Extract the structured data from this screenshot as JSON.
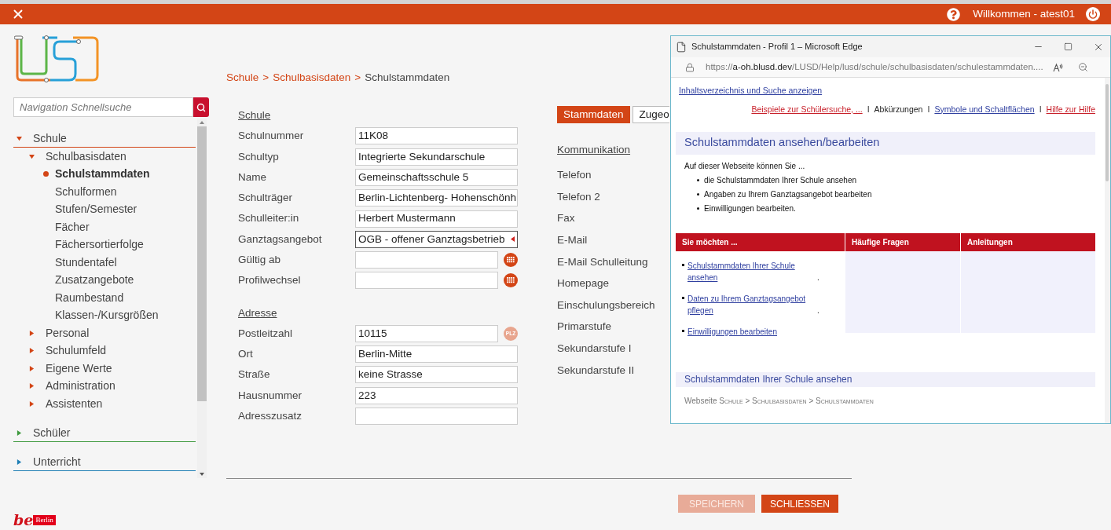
{
  "topbar": {
    "welcome": "Willkommen - atest01"
  },
  "search": {
    "placeholder": "Navigation Schnellsuche"
  },
  "nav": [
    {
      "label": "Schule",
      "color": "#d34516",
      "expanded": true,
      "children": [
        {
          "label": "Schulbasisdaten",
          "expanded": true,
          "children": [
            {
              "label": "Schulstammdaten",
              "selected": true
            },
            {
              "label": "Schulformen",
              "selected": false
            },
            {
              "label": "Stufen/Semester",
              "selected": false
            },
            {
              "label": "Fächer",
              "selected": false
            },
            {
              "label": "Fächersortierfolge",
              "selected": false
            },
            {
              "label": "Stundentafel",
              "selected": false
            },
            {
              "label": "Zusatzangebote",
              "selected": false
            },
            {
              "label": "Raumbestand",
              "selected": false
            },
            {
              "label": "Klassen-/Kursgrößen",
              "selected": false
            }
          ]
        },
        {
          "label": "Personal",
          "expanded": false
        },
        {
          "label": "Schulumfeld",
          "expanded": false
        },
        {
          "label": "Eigene Werte",
          "expanded": false
        },
        {
          "label": "Administration",
          "expanded": false
        },
        {
          "label": "Assistenten",
          "expanded": false
        }
      ]
    },
    {
      "label": "Schüler",
      "color": "#3f9a3f",
      "expanded": false
    },
    {
      "label": "Unterricht",
      "color": "#1f7fb5",
      "expanded": false
    }
  ],
  "footer_logo": {
    "mark": "be",
    "name": "Berlin"
  },
  "breadcrumb": [
    {
      "label": "Schule",
      "link": true
    },
    {
      "label": "Schulbasisdaten",
      "link": true
    },
    {
      "label": "Schulstammdaten",
      "link": false
    }
  ],
  "breadcrumb_separator": ">",
  "school": {
    "heading": "Schule",
    "fields": [
      {
        "label": "Schulnummer",
        "kind": "text",
        "value": "11K08"
      },
      {
        "label": "Schultyp",
        "kind": "text",
        "value": "Integrierte Sekundarschule"
      },
      {
        "label": "Name",
        "kind": "text",
        "value": "Gemeinschaftsschule 5"
      },
      {
        "label": "Schulträger",
        "kind": "text",
        "value": "Berlin-Lichtenberg- Hohenschönh"
      },
      {
        "label": "Schulleiter:in",
        "kind": "text",
        "value": "Herbert Mustermann"
      },
      {
        "label": "Ganztagsangebot",
        "kind": "select",
        "value": "OGB - offener Ganztagsbetrieb"
      },
      {
        "label": "Gültig ab",
        "kind": "date"
      },
      {
        "label": "Profilwechsel",
        "kind": "date"
      }
    ]
  },
  "address": {
    "heading": "Adresse",
    "fields": [
      {
        "label": "Postleitzahl",
        "kind": "plz",
        "value": "10115",
        "badge": "PLZ"
      },
      {
        "label": "Ort",
        "kind": "text",
        "value": "Berlin-Mitte"
      },
      {
        "label": "Straße",
        "kind": "text",
        "value": "keine Strasse"
      },
      {
        "label": "Hausnummer",
        "kind": "text",
        "value": "223"
      },
      {
        "label": "Adresszusatz",
        "kind": "text"
      }
    ]
  },
  "tabs": [
    {
      "label": "Stammdaten",
      "selected": true
    },
    {
      "label": "Zugeo",
      "selected": false
    }
  ],
  "communication": {
    "heading": "Kommunikation",
    "labels": [
      "Telefon",
      "Telefon 2",
      "Fax",
      "E-Mail",
      "E-Mail Schulleitung",
      "Homepage",
      "Einschulungsbereich",
      "Primarstufe",
      "Sekundarstufe I",
      "Sekundarstufe II"
    ]
  },
  "buttons": [
    {
      "label": "SPEICHERN",
      "disabled": true
    },
    {
      "label": "SCHLIESSEN",
      "disabled": false
    }
  ],
  "browser": {
    "title": "Schulstammdaten - Profil 1 – Microsoft Edge",
    "url_prefix": "https://",
    "url_host": "a-oh.blusd.dev",
    "url_path": "/LUSD/Help/lusd/schule/schulbasisdaten/schulestammdaten....",
    "toc_link": "Inhaltsverzeichnis und Suche anzeigen",
    "top_links": [
      {
        "label": "Beispiele zur Schülersuche, ...",
        "kind": "red_link"
      },
      {
        "label": "I",
        "kind": "separator"
      },
      {
        "label": "Abkürzungen",
        "kind": "plain"
      },
      {
        "label": "I",
        "kind": "separator"
      },
      {
        "label": "Symbole und Schaltflächen",
        "kind": "blue_link"
      },
      {
        "label": "I",
        "kind": "separator"
      },
      {
        "label": "Hilfe zur Hilfe",
        "kind": "red_link"
      }
    ],
    "heading": "Schulstammdaten ansehen/bearbeiten",
    "intro": "Auf dieser Webseite können Sie ...",
    "bullets": [
      "die Schulstammdaten Ihrer Schule ansehen",
      "Angaben zu Ihrem Ganztagsangebot bearbeiten",
      "Einwilligungen bearbeiten."
    ],
    "table": {
      "columns": [
        "Sie möchten ...",
        "Häufige Fragen",
        "Anleitungen"
      ],
      "items": [
        {
          "link": "Schulstammdaten Ihrer Schule ansehen",
          "after": "."
        },
        {
          "link": "Daten zu Ihrem Ganztagsangebot pflegen",
          "after": "."
        },
        {
          "link": "Einwilligungen bearbeiten"
        }
      ]
    },
    "section_heading": "Schulstammdaten Ihrer Schule ansehen",
    "path_prefix": "Webseite",
    "path": "Schule > Schulbasisdaten > Schulstammdaten"
  }
}
